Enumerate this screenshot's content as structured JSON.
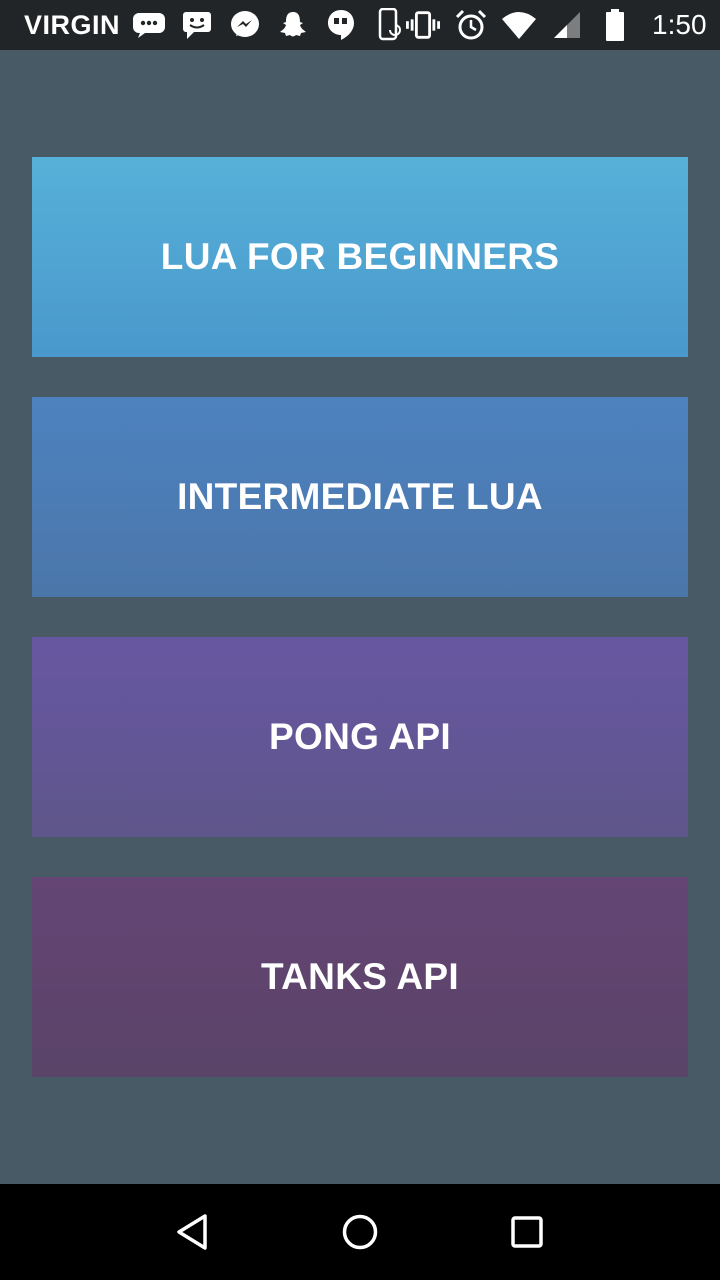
{
  "status_bar": {
    "carrier": "VIRGIN",
    "time": "1:50",
    "notification_icons": [
      "sms-icon",
      "message-icon",
      "messenger-icon",
      "snapchat-icon",
      "hangouts-icon",
      "phone-rotate-icon"
    ],
    "system_icons": [
      "vibrate-icon",
      "alarm-icon",
      "wifi-icon",
      "cell-signal-icon",
      "battery-icon"
    ]
  },
  "menu": {
    "items": [
      {
        "label": "LUA FOR BEGINNERS"
      },
      {
        "label": "INTERMEDIATE LUA"
      },
      {
        "label": "PONG API"
      },
      {
        "label": "TANKS API"
      }
    ]
  },
  "nav_bar": {
    "buttons": [
      "back-icon",
      "home-icon",
      "recents-icon"
    ]
  },
  "colors": {
    "background": "#475a66",
    "status_bar": "#222527",
    "nav_bar": "#000000",
    "button_1": "#50a4d2",
    "button_2": "#4c7cb5",
    "button_3": "#635697",
    "button_4": "#5f446e"
  }
}
